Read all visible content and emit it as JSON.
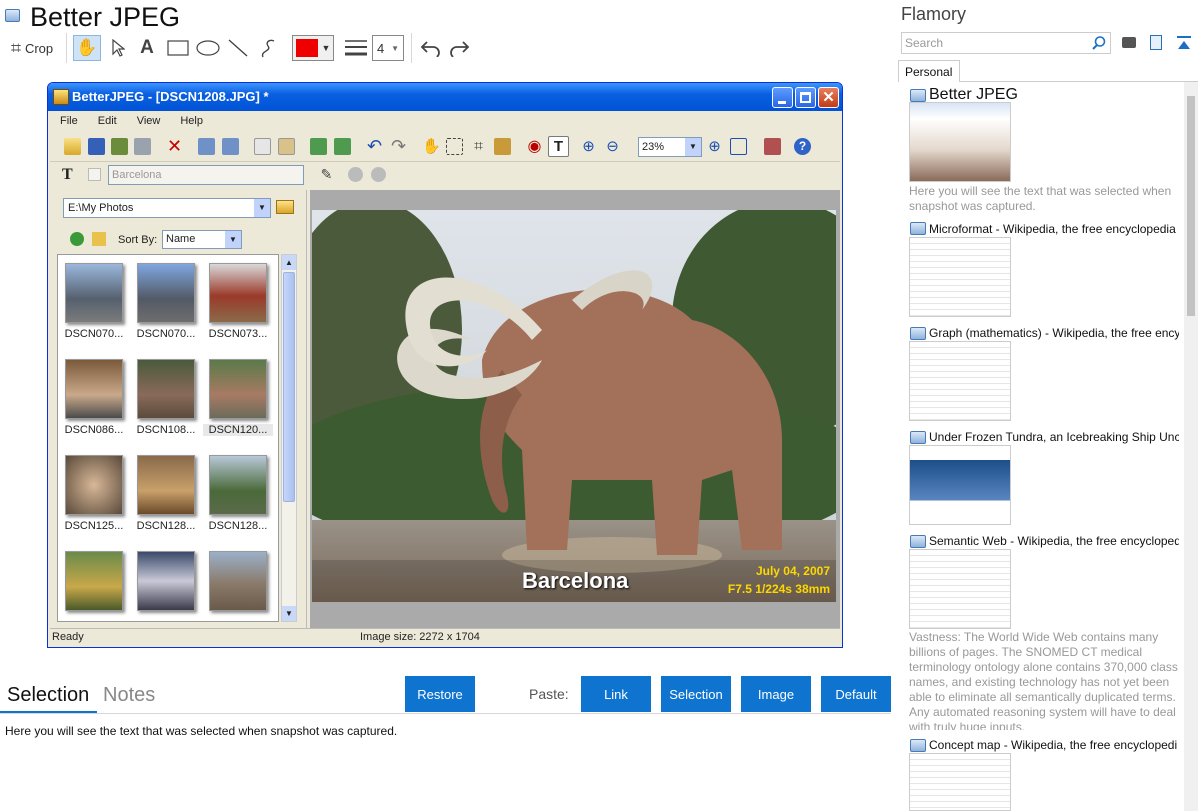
{
  "app": {
    "title": "Better JPEG"
  },
  "toolbar": {
    "crop_label": "Crop",
    "text_tool": "A",
    "line_width_value": "4",
    "color": "#ee0000"
  },
  "window": {
    "title": "BetterJPEG - [DSCN1208.JPG] *",
    "menu": [
      "File",
      "Edit",
      "View",
      "Help"
    ],
    "zoom_value": "23%",
    "text_placeholder": "Barcelona",
    "folder": "E:\\My Photos",
    "sort_label": "Sort By:",
    "sort_value": "Name",
    "thumbnails": [
      "DSCN070...",
      "DSCN070...",
      "DSCN073...",
      "DSCN086...",
      "DSCN108...",
      "DSCN120...",
      "DSCN125...",
      "DSCN128...",
      "DSCN128...",
      "",
      "",
      ""
    ],
    "photo_caption": "Barcelona",
    "photo_date": "July 04, 2007",
    "photo_exif": "F7.5  1/224s 38mm",
    "status_ready": "Ready",
    "status_size": "Image size:  2272 x 1704"
  },
  "lower": {
    "tab_selection": "Selection",
    "tab_notes": "Notes",
    "restore_button": "Restore",
    "paste_label": "Paste:",
    "paste_link": "Link",
    "paste_selection": "Selection",
    "paste_image": "Image",
    "paste_default": "Default",
    "selection_text": "Here you will see the text that was selected when snapshot was captured."
  },
  "flamory": {
    "title": "Flamory",
    "search_placeholder": "Search",
    "tab_personal": "Personal",
    "snapshots": [
      {
        "title": "Better JPEG",
        "text": "Here you will see the text that was selected when snapshot was captured."
      },
      {
        "title": "Microformat - Wikipedia, the free encyclopedia"
      },
      {
        "title": "Graph (mathematics) - Wikipedia, the free ency"
      },
      {
        "title": "Under Frozen Tundra, an Icebreaking Ship Unco"
      },
      {
        "title": "Semantic Web - Wikipedia, the free encycloped",
        "text": "Vastness: The World Wide Web contains many billions of pages. The SNOMED CT medical terminology ontology alone contains 370,000 class names, and existing technology has not yet been able to eliminate all semantically duplicated terms. Any automated reasoning system will have to deal with truly huge inputs."
      },
      {
        "title": "Concept map - Wikipedia, the free encyclopedi"
      }
    ]
  }
}
